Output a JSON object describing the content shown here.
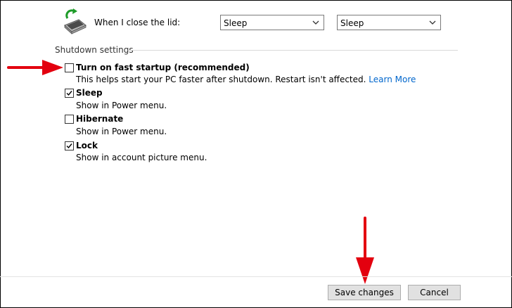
{
  "lid_row": {
    "icon": "laptop-power-icon",
    "label": "When I close the lid:",
    "on_battery": "Sleep",
    "plugged_in": "Sleep"
  },
  "shutdown": {
    "section_title": "Shutdown settings",
    "options": [
      {
        "title": "Turn on fast startup (recommended)",
        "description": "This helps start your PC faster after shutdown. Restart isn't affected.",
        "link": "Learn More",
        "checked": false
      },
      {
        "title": "Sleep",
        "description": "Show in Power menu.",
        "checked": true
      },
      {
        "title": "Hibernate",
        "description": "Show in Power menu.",
        "checked": false
      },
      {
        "title": "Lock",
        "description": "Show in account picture menu.",
        "checked": true
      }
    ]
  },
  "buttons": {
    "save": "Save changes",
    "cancel": "Cancel"
  },
  "annotation_color": "#e3000f"
}
